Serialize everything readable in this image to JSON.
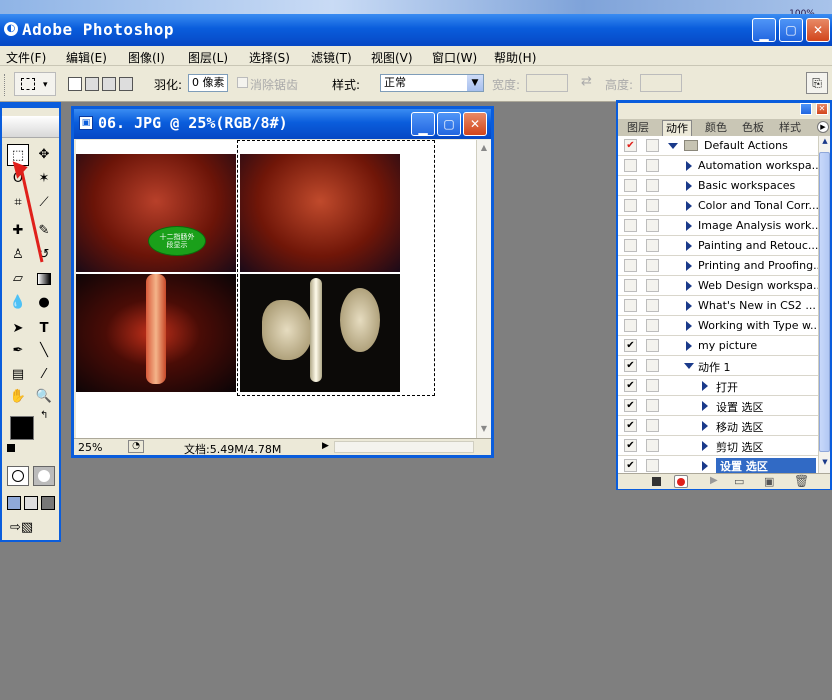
{
  "desktop": {
    "zoom_badge": "100%"
  },
  "app": {
    "title": "Adobe Photoshop",
    "icon": "photoshop-icon"
  },
  "menu": [
    "文件(F)",
    "编辑(E)",
    "图像(I)",
    "图层(L)",
    "选择(S)",
    "滤镜(T)",
    "视图(V)",
    "窗口(W)",
    "帮助(H)"
  ],
  "options": {
    "feather_label": "羽化:",
    "feather_value": "0 像素",
    "antialias_label": "消除锯齿",
    "style_label": "样式:",
    "style_value": "正常",
    "width_label": "宽度:",
    "height_label": "高度:"
  },
  "document": {
    "title": "06. JPG @ 25%(RGB/8#)",
    "zoom": "25%",
    "doc_size": "文档:5.49M/4.78M",
    "callout_text": "十二指肠外\n段显示"
  },
  "panel": {
    "tabs": [
      "图层",
      "动作",
      "颜色",
      "色板",
      "样式"
    ],
    "active_tab": "动作",
    "actions": [
      {
        "label": "Default Actions",
        "checked": true,
        "type": "set",
        "red": true
      },
      {
        "label": "Automation workspa...",
        "checked": false,
        "type": "set"
      },
      {
        "label": "Basic workspaces",
        "checked": false,
        "type": "set"
      },
      {
        "label": "Color and Tonal Corr...",
        "checked": false,
        "type": "set"
      },
      {
        "label": "Image Analysis work...",
        "checked": false,
        "type": "set"
      },
      {
        "label": "Painting and Retouc...",
        "checked": false,
        "type": "set"
      },
      {
        "label": "Printing and Proofing...",
        "checked": false,
        "type": "set"
      },
      {
        "label": "Web Design workspa...",
        "checked": false,
        "type": "set"
      },
      {
        "label": "What's New in CS2 ...",
        "checked": false,
        "type": "set"
      },
      {
        "label": "Working with Type w...",
        "checked": false,
        "type": "set"
      },
      {
        "label": "my picture",
        "checked": true,
        "type": "set"
      },
      {
        "label": "动作 1",
        "checked": true,
        "type": "action-open"
      },
      {
        "label": "打开",
        "checked": true,
        "type": "step"
      },
      {
        "label": "设置 选区",
        "checked": true,
        "type": "step"
      },
      {
        "label": "移动 选区",
        "checked": true,
        "type": "step"
      },
      {
        "label": "剪切 选区",
        "checked": true,
        "type": "step"
      },
      {
        "label": "设置 选区",
        "checked": true,
        "type": "step",
        "selected": true
      }
    ]
  },
  "colors": {
    "xp_blue": "#0a5ddc",
    "chrome": "#ece9d8",
    "selected_row": "#316ac5",
    "arrow_red": "#e0201b"
  }
}
